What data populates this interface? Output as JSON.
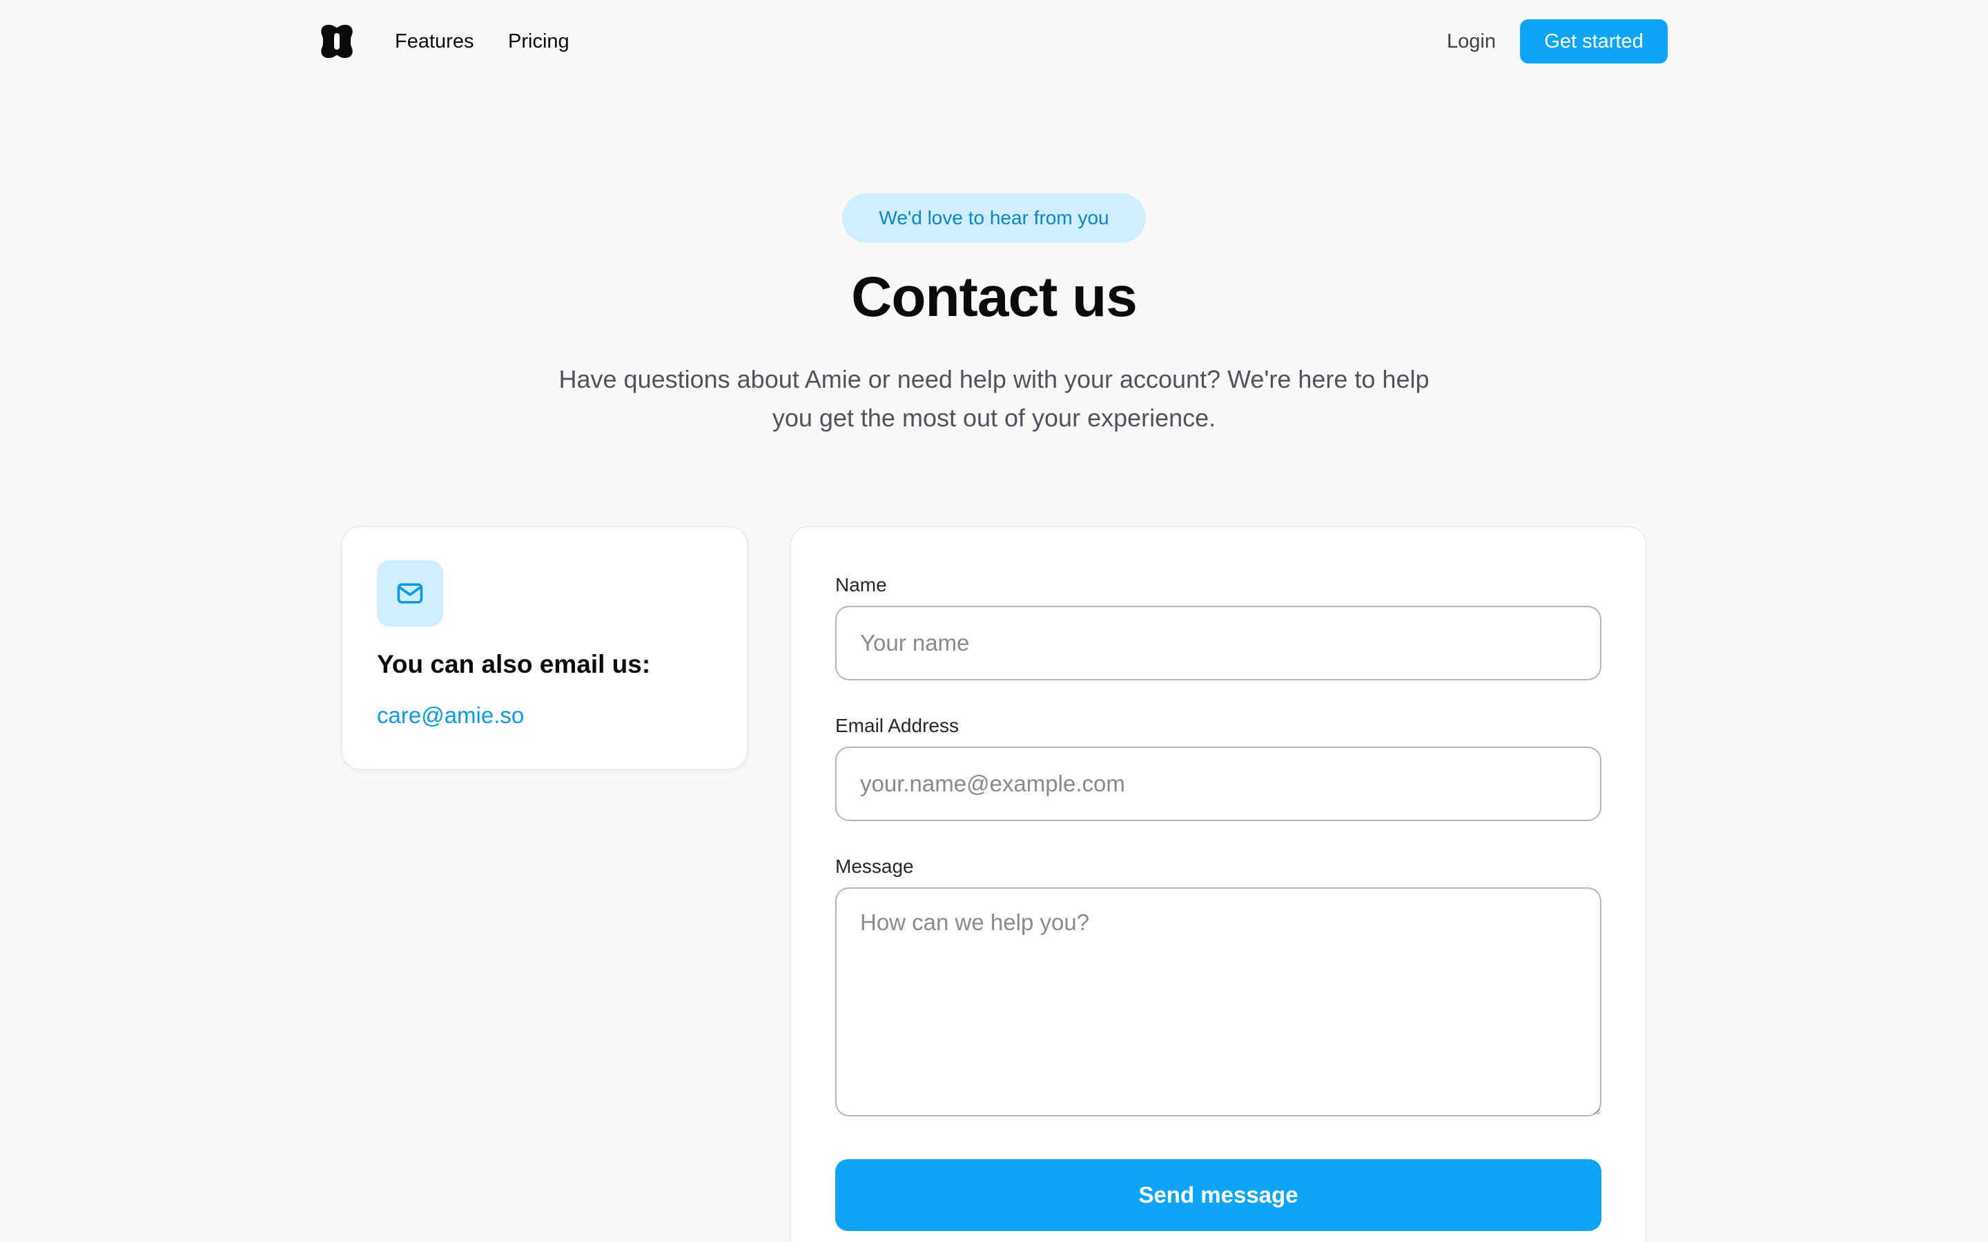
{
  "header": {
    "logo_icon": "amie-logo-icon",
    "nav": [
      {
        "label": "Features"
      },
      {
        "label": "Pricing"
      }
    ],
    "login_label": "Login",
    "cta_label": "Get started"
  },
  "hero": {
    "pill": "We'd love to hear from you",
    "title": "Contact us",
    "subtitle": "Have questions about Amie or need help with your account? We're here to help you get the most out of your experience."
  },
  "email_card": {
    "icon": "mail-icon",
    "heading": "You can also email us:",
    "email": "care@amie.so"
  },
  "form": {
    "name": {
      "label": "Name",
      "placeholder": "Your name",
      "value": ""
    },
    "email": {
      "label": "Email Address",
      "placeholder": "your.name@example.com",
      "value": ""
    },
    "message": {
      "label": "Message",
      "placeholder": "How can we help you?",
      "value": ""
    },
    "submit_label": "Send message"
  },
  "colors": {
    "accent": "#0ea5f7",
    "accent_light": "#cfeeff",
    "link": "#0e97e4",
    "background": "#f9f9f9"
  }
}
